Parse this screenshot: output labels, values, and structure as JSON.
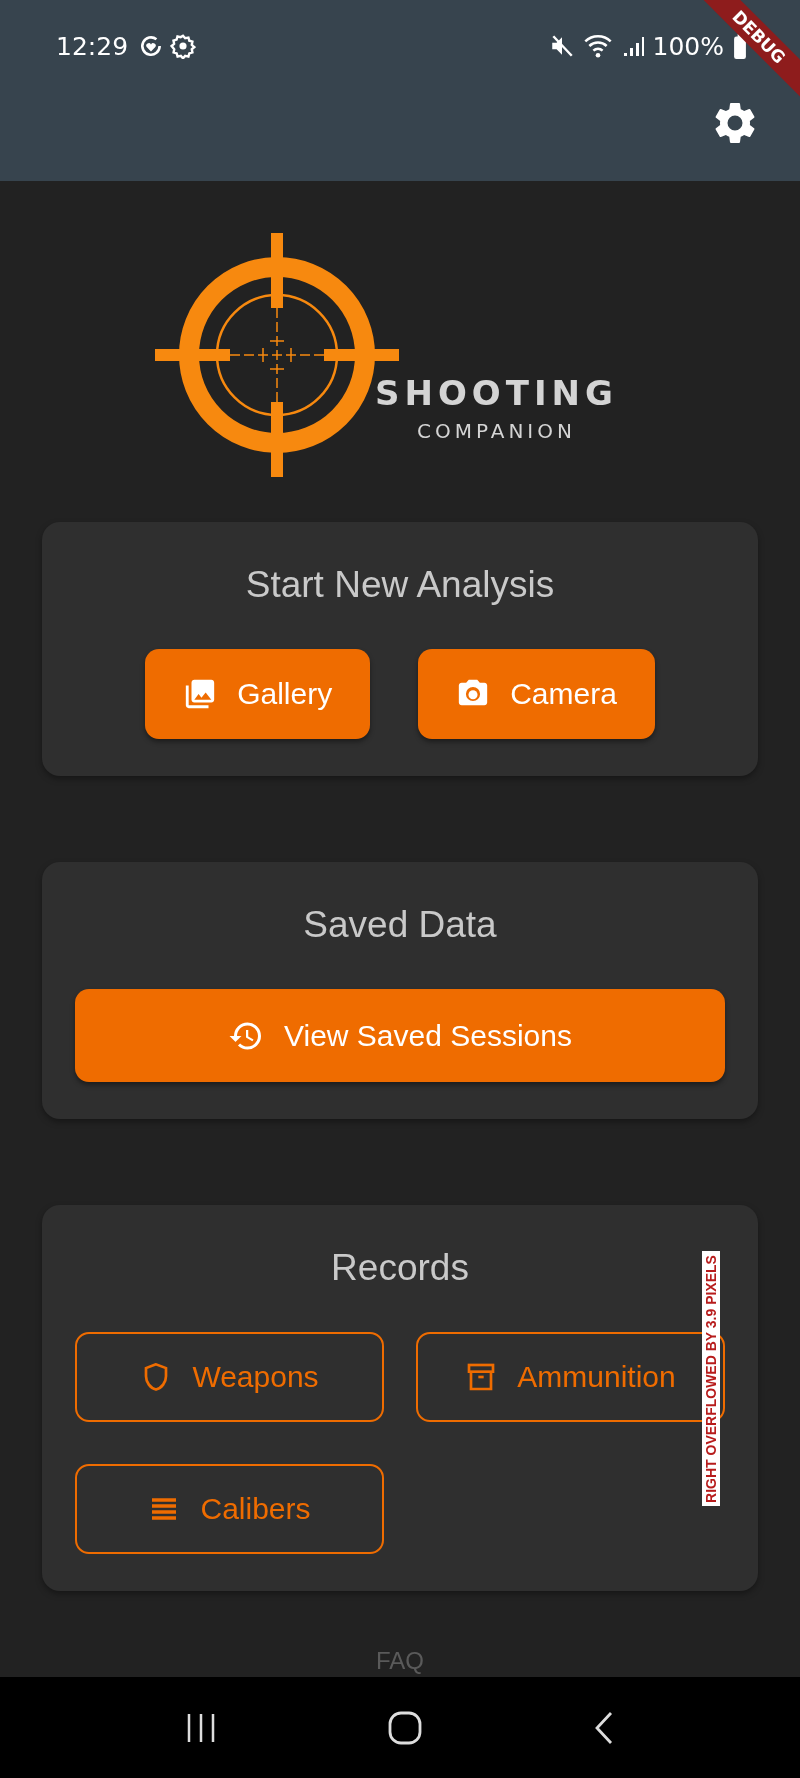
{
  "status_bar": {
    "time": "12:29",
    "battery": "100%"
  },
  "debug_banner": "DEBUG",
  "logo": {
    "title": "SHOOTING",
    "subtitle": "COMPANION"
  },
  "sections": [
    {
      "title": "Start New Analysis",
      "kind": "pair",
      "buttons": [
        {
          "label": "Gallery",
          "kind": "filled"
        },
        {
          "label": "Camera",
          "kind": "filled"
        }
      ]
    },
    {
      "title": "Saved Data",
      "kind": "wide",
      "buttons": [
        {
          "label": "View Saved Sessions",
          "kind": "filled"
        }
      ]
    },
    {
      "title": "Records",
      "kind": "grid",
      "buttons": [
        {
          "label": "Weapons",
          "kind": "outlined"
        },
        {
          "label": "Ammunition",
          "kind": "outlined"
        },
        {
          "label": "Calibers",
          "kind": "outlined"
        }
      ],
      "overflow_warning": "RIGHT OVERFLOWED BY 3.9 PIXELS"
    }
  ],
  "footer_link": "FAQ"
}
